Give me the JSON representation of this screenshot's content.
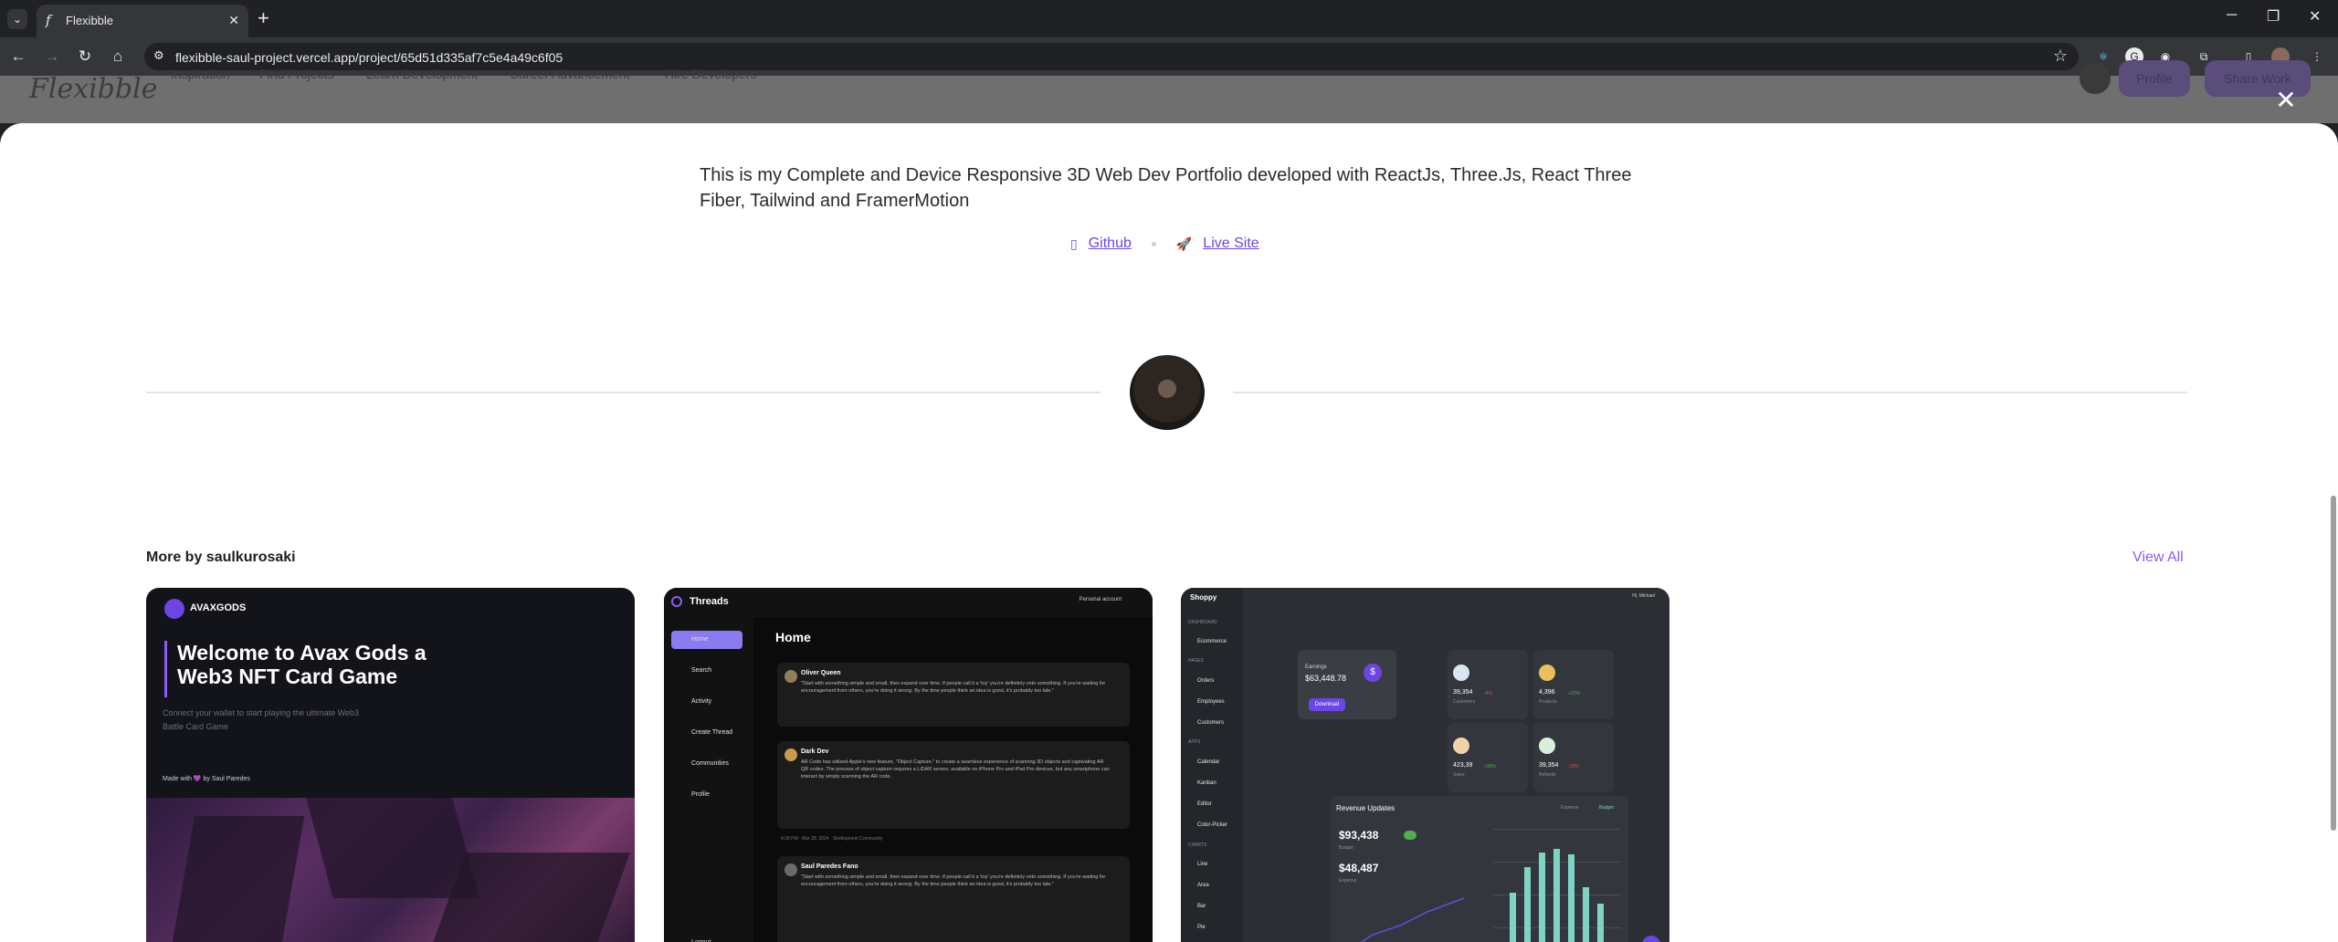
{
  "browser": {
    "tab_title": "Flexibble",
    "url": "flexibble-saul-project.vercel.app/project/65d51d335af7c5e4a49c6f05",
    "favicon_letter": "f"
  },
  "site_nav": {
    "logo": "Flexibble",
    "links": [
      "Inspiration",
      "Find Projects",
      "Learn Development",
      "Career Advancement",
      "Hire Developers"
    ],
    "profile_button": "Profile",
    "share_button": "Share Work"
  },
  "project": {
    "description": "This is my Complete and Device Responsive 3D Web Dev Portfolio developed with ReactJs, Three.Js, React Three Fiber, Tailwind and FramerMotion",
    "github_label": "Github",
    "live_label": "Live Site"
  },
  "more_by": {
    "title": "More by saulkurosaki",
    "view_all": "View All"
  },
  "cards": {
    "avax": {
      "logo": "AVAXGODS",
      "heading": "Welcome to Avax Gods a Web3 NFT Card Game",
      "sub": "Connect your wallet to start playing the ultimate Web3 Battle Card Game",
      "made": "Made with 💜 by Saul Paredes"
    },
    "threads": {
      "brand": "Threads",
      "account": "Personal account",
      "nav": [
        "Home",
        "Search",
        "Activity",
        "Create Thread",
        "Communities",
        "Profile",
        "Logout"
      ],
      "page_title": "Home",
      "posts": [
        {
          "name": "Oliver Queen",
          "text": "\"Start with something simple and small, then expand over time. If people call it a 'toy' you're definitely onto something. If you're waiting for encouragement from others, you're doing it wrong. By the time people think an idea is good, it's probably too late.\""
        },
        {
          "name": "Dark Dev",
          "text": "AR Code has utilized Apple's new feature, \"Object Capture,\" to create a seamless experience of scanning 3D objects and captivating AR QR codes. The process of object capture requires a LiDAR sensor, available on iPhone Pro and iPad Pro devices, but any smartphone can interact by simply scanning the AR code."
        },
        {
          "name": "Saul Paredes Fano",
          "text": "\"Start with something simple and small, then expand over time. If people call it a 'toy' you're definitely onto something. If you're waiting for encouragement from others, you're doing it wrong. By the time people think an idea is good, it's probably too late.\""
        }
      ],
      "post_meta": "4:38 PM · Mar 28, 2024 · Shellopment Community"
    },
    "shoppy": {
      "brand": "Shoppy",
      "sections": [
        "DASHBOARD",
        "PAGES",
        "APPS",
        "CHARTS"
      ],
      "items": [
        "Ecommerce",
        "Orders",
        "Employees",
        "Customers",
        "Calendar",
        "Kanban",
        "Editor",
        "Color-Picker",
        "Line",
        "Area",
        "Bar",
        "Pie"
      ],
      "earnings_label": "Earnings",
      "earnings_value": "$63,448.78",
      "download": "Download",
      "stats": [
        {
          "value": "39,354",
          "change": "-4%",
          "label": "Customers"
        },
        {
          "value": "4,396",
          "change": "+23%",
          "label": "Products"
        },
        {
          "value": "423,39",
          "change": "+38%",
          "label": "Sales"
        },
        {
          "value": "39,354",
          "change": "-12%",
          "label": "Refunds"
        }
      ],
      "revenue_title": "Revenue Updates",
      "legend": [
        "Expense",
        "Budget"
      ],
      "budget": "$93,438",
      "budget_label": "Budget",
      "expense": "$48,487",
      "expense_label": "Expense",
      "user": "Hi, Michael",
      "bars": [
        0.55,
        0.78,
        0.92,
        0.95,
        0.9,
        0.6,
        0.45
      ]
    }
  }
}
